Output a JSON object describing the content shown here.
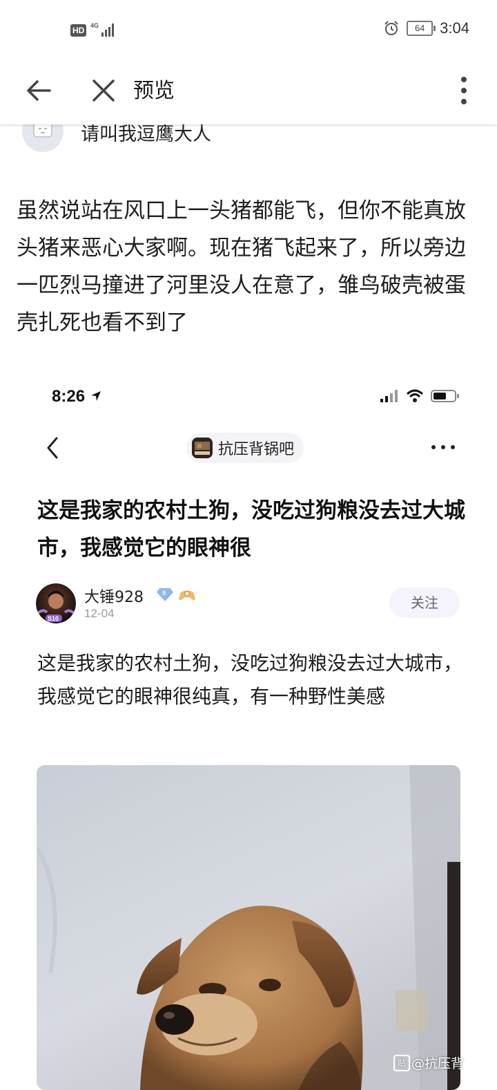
{
  "status_bar": {
    "network": "HD",
    "signal_type": "4G",
    "battery": "64",
    "time": "3:04",
    "alarm_icon": "alarm-clock-icon"
  },
  "top_bar": {
    "title": "预览",
    "back_icon": "arrow-left-icon",
    "close_icon": "close-icon",
    "more_icon": "more-vertical-icon"
  },
  "comment": {
    "author": "请叫我逗鹰大人",
    "text": "虽然说站在风口上一头猪都能飞，但你不能真放头猪来恶心大家啊。现在猪飞起来了，所以旁边一匹烈马撞进了河里没人在意了，雏鸟破壳被蛋壳扎死也看不到了"
  },
  "embedded": {
    "status_time": "8:26",
    "forum_name": "抗压背锅吧",
    "post_title": "这是我家的农村土狗，没吃过狗粮没去过大城市，我感觉它的眼神很",
    "poster": {
      "name": "大锤928",
      "level": "9",
      "date": "12-04",
      "avatar_tag": "S10"
    },
    "follow_label": "关注",
    "post_body": "这是我家的农村土狗，没吃过狗粮没去过大城市，我感觉它的眼神很纯真，有一种野性美感",
    "watermark": "@抗压背",
    "watermark_icon_text": "贴"
  }
}
